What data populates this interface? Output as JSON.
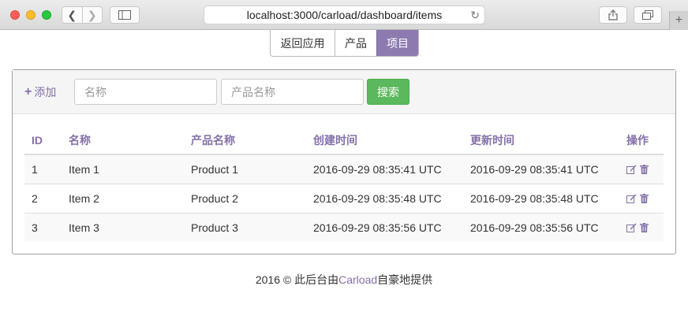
{
  "browser": {
    "url": "localhost:3000/carload/dashboard/items",
    "back_icon": "chevron-left-icon",
    "forward_icon": "chevron-right-icon",
    "sidebar_icon": "sidebar-icon",
    "reload_icon": "reload-icon",
    "share_icon": "share-icon",
    "tabs_icon": "tabs-icon",
    "new_tab_label": "+"
  },
  "topnav": {
    "items": [
      {
        "label": "返回应用"
      },
      {
        "label": "产品"
      },
      {
        "label": "项目",
        "active": true
      }
    ],
    "active_color": "#8d7bb0"
  },
  "toolbar": {
    "add_label": "添加",
    "name_placeholder": "名称",
    "product_placeholder": "产品名称",
    "search_label": "搜索"
  },
  "table": {
    "headers": [
      "ID",
      "名称",
      "产品名称",
      "创建时间",
      "更新时间",
      "操作"
    ],
    "rows": [
      {
        "id": "1",
        "name": "Item 1",
        "product": "Product 1",
        "created": "2016-09-29 08:35:41 UTC",
        "updated": "2016-09-29 08:35:41 UTC"
      },
      {
        "id": "2",
        "name": "Item 2",
        "product": "Product 2",
        "created": "2016-09-29 08:35:48 UTC",
        "updated": "2016-09-29 08:35:48 UTC"
      },
      {
        "id": "3",
        "name": "Item 3",
        "product": "Product 3",
        "created": "2016-09-29 08:35:56 UTC",
        "updated": "2016-09-29 08:35:56 UTC"
      }
    ],
    "row_icons": [
      "edit-icon",
      "trash-icon"
    ]
  },
  "footer": {
    "prefix": "2016 © 此后台由",
    "link": "Carload",
    "suffix": "自豪地提供"
  },
  "colors": {
    "accent": "#8470a8",
    "success": "#5cb85c"
  }
}
